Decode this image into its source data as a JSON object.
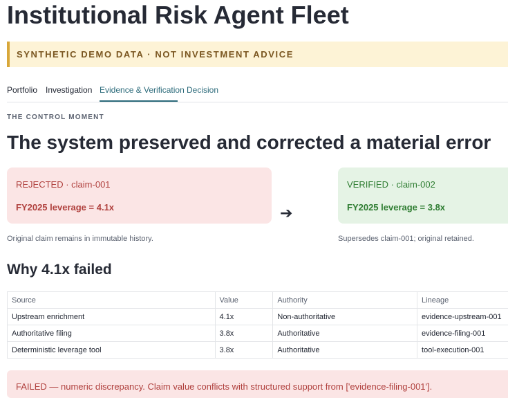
{
  "app": {
    "title": "Institutional Risk Agent Fleet"
  },
  "banner": {
    "text": "SYNTHETIC DEMO DATA · NOT INVESTMENT ADVICE",
    "accent": "#d8a73a"
  },
  "tabs": [
    {
      "label": "Portfolio",
      "active": false
    },
    {
      "label": "Investigation",
      "active": false
    },
    {
      "label": "Evidence & Verification",
      "active": true
    },
    {
      "label": "Decision",
      "active": false
    }
  ],
  "control": {
    "kicker": "THE CONTROL MOMENT",
    "headline": "The system preserved and corrected a material error",
    "rejected": {
      "label": "REJECTED · claim-001",
      "value": "FY2025 leverage = 4.1x",
      "note": "Original claim remains in immutable history.",
      "color": "#b0413e"
    },
    "arrow": "➔",
    "verified": {
      "label": "VERIFIED · claim-002",
      "value": "FY2025 leverage = 3.8x",
      "note": "Supersedes claim-001; original retained.",
      "color": "#2f7d32"
    }
  },
  "why": {
    "title": "Why 4.1x failed",
    "columns": [
      "Source",
      "Value",
      "Authority",
      "Lineage"
    ],
    "rows": [
      [
        "Upstream enrichment",
        "4.1x",
        "Non-authoritative",
        "evidence-upstream-001"
      ],
      [
        "Authoritative filing",
        "3.8x",
        "Authoritative",
        "evidence-filing-001"
      ],
      [
        "Deterministic leverage tool",
        "3.8x",
        "Authoritative",
        "tool-execution-001"
      ]
    ]
  },
  "failure": {
    "text": "FAILED — numeric discrepancy. Claim value conflicts with structured support from ['evidence-filing-001']."
  }
}
